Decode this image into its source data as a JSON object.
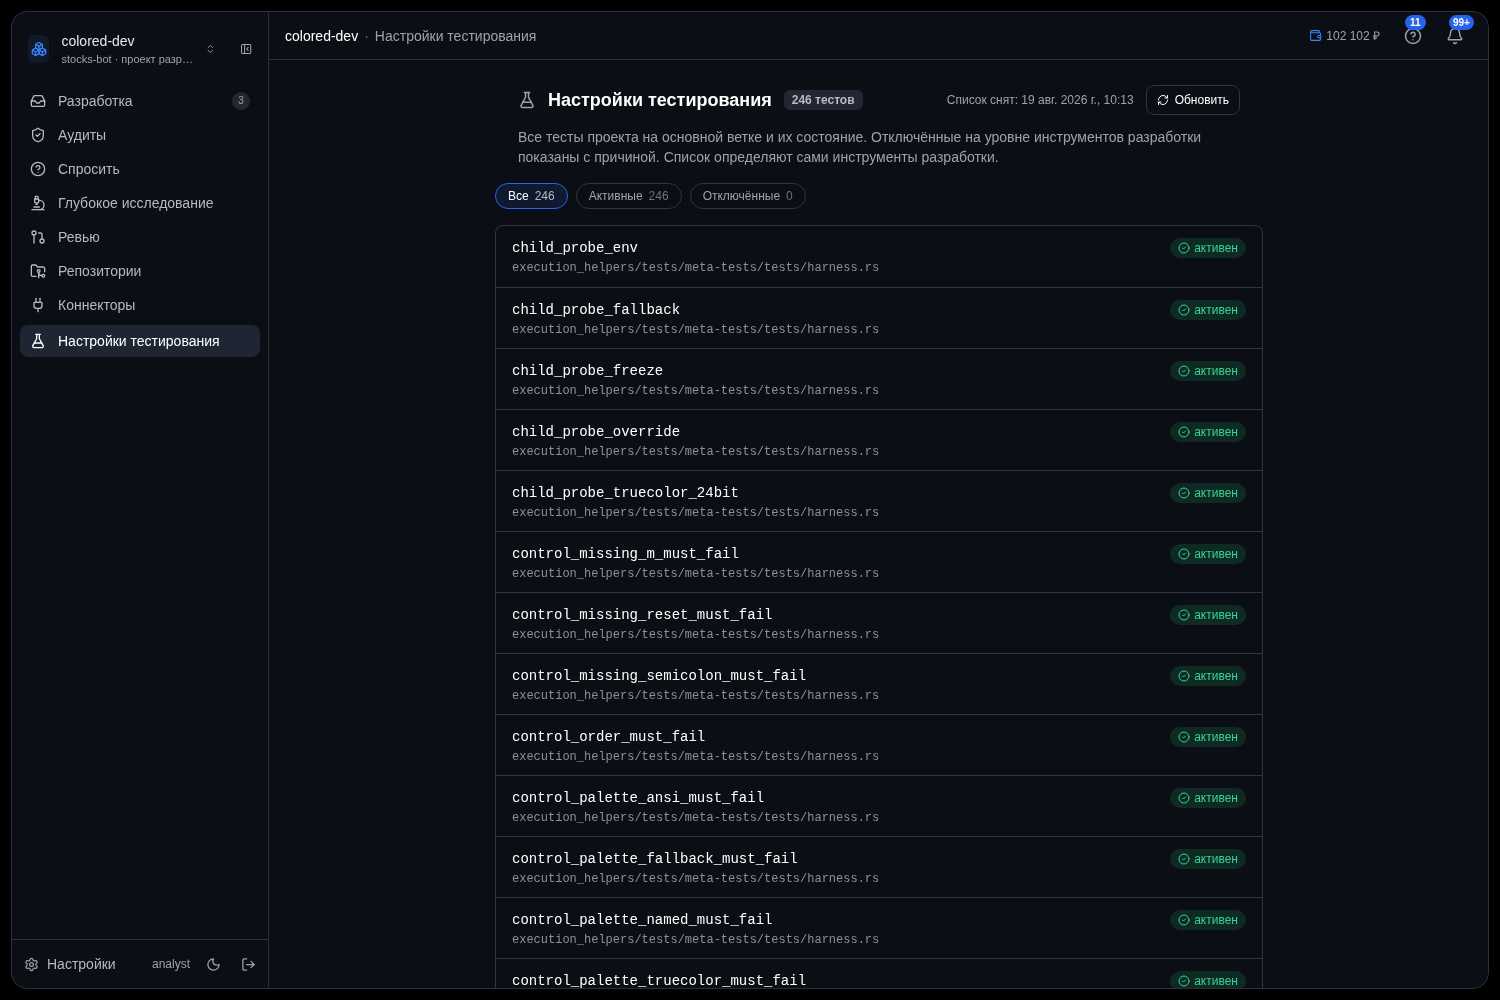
{
  "workspace": {
    "name": "colored-dev",
    "subtitle": "stocks-bot · проект разр…"
  },
  "nav": [
    {
      "label": "Разработка",
      "badge": "3",
      "selected": false
    },
    {
      "label": "Аудиты",
      "selected": false
    },
    {
      "label": "Спросить",
      "selected": false
    },
    {
      "label": "Глубокое исследование",
      "selected": false
    },
    {
      "label": "Ревью",
      "selected": false
    },
    {
      "label": "Репозитории",
      "selected": false
    },
    {
      "label": "Коннекторы",
      "selected": false
    },
    {
      "label": "Настройки тестирования",
      "selected": true
    }
  ],
  "sidebar_footer": {
    "settings": "Настройки",
    "user": "analyst"
  },
  "breadcrumb": [
    "colored-dev",
    "·",
    "Настройки тестирования"
  ],
  "topbar": {
    "balance": "102 102 ₽",
    "help_badge": "11",
    "notifications_badge": "99+"
  },
  "page": {
    "title": "Настройки тестирования",
    "count_badge": "246 тестов",
    "snapshot": "Список снят: 19 авг. 2026 г., 10:13",
    "refresh": "Обновить",
    "description": "Все тесты проекта на основной ветке и их состояние. Отключённые на уровне инструментов разработки показаны с причиной. Список определяют сами инструменты разработки."
  },
  "filters": [
    {
      "label": "Все",
      "count": "246",
      "selected": true
    },
    {
      "label": "Активные",
      "count": "246",
      "selected": false
    },
    {
      "label": "Отключённые",
      "count": "0",
      "selected": false
    }
  ],
  "tests": [
    {
      "name": "child_probe_env",
      "path": "execution_helpers/tests/meta-tests/tests/harness.rs",
      "status": {
        "kind": "active",
        "label": "активен"
      }
    },
    {
      "name": "child_probe_fallback",
      "path": "execution_helpers/tests/meta-tests/tests/harness.rs",
      "status": {
        "kind": "active",
        "label": "активен"
      }
    },
    {
      "name": "child_probe_freeze",
      "path": "execution_helpers/tests/meta-tests/tests/harness.rs",
      "status": {
        "kind": "active",
        "label": "активен"
      }
    },
    {
      "name": "child_probe_override",
      "path": "execution_helpers/tests/meta-tests/tests/harness.rs",
      "status": {
        "kind": "active",
        "label": "активен"
      }
    },
    {
      "name": "child_probe_truecolor_24bit",
      "path": "execution_helpers/tests/meta-tests/tests/harness.rs",
      "status": {
        "kind": "active",
        "label": "активен"
      }
    },
    {
      "name": "control_missing_m_must_fail",
      "path": "execution_helpers/tests/meta-tests/tests/harness.rs",
      "status": {
        "kind": "active",
        "label": "активен"
      }
    },
    {
      "name": "control_missing_reset_must_fail",
      "path": "execution_helpers/tests/meta-tests/tests/harness.rs",
      "status": {
        "kind": "active",
        "label": "активен"
      }
    },
    {
      "name": "control_missing_semicolon_must_fail",
      "path": "execution_helpers/tests/meta-tests/tests/harness.rs",
      "status": {
        "kind": "active",
        "label": "активен"
      }
    },
    {
      "name": "control_order_must_fail",
      "path": "execution_helpers/tests/meta-tests/tests/harness.rs",
      "status": {
        "kind": "active",
        "label": "активен"
      }
    },
    {
      "name": "control_palette_ansi_must_fail",
      "path": "execution_helpers/tests/meta-tests/tests/harness.rs",
      "status": {
        "kind": "active",
        "label": "активен"
      }
    },
    {
      "name": "control_palette_fallback_must_fail",
      "path": "execution_helpers/tests/meta-tests/tests/harness.rs",
      "status": {
        "kind": "active",
        "label": "активен"
      }
    },
    {
      "name": "control_palette_named_must_fail",
      "path": "execution_helpers/tests/meta-tests/tests/harness.rs",
      "status": {
        "kind": "active",
        "label": "активен"
      }
    },
    {
      "name": "control_palette_truecolor_must_fail",
      "status": {
        "kind": "active",
        "label": "активен"
      }
    }
  ]
}
